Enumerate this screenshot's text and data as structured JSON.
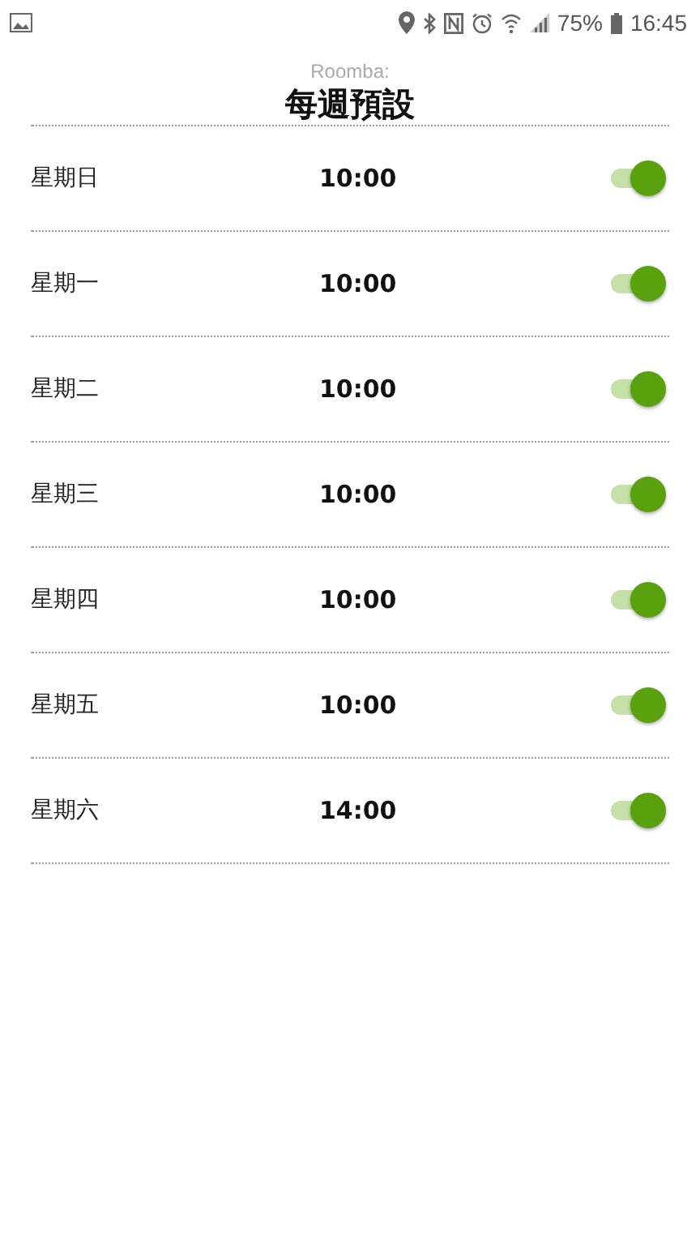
{
  "status_bar": {
    "battery": "75%",
    "time": "16:45"
  },
  "header": {
    "subtitle": "Roomba:",
    "title": "每週預設"
  },
  "schedule": [
    {
      "day": "星期日",
      "time": "10:00",
      "on": true
    },
    {
      "day": "星期一",
      "time": "10:00",
      "on": true
    },
    {
      "day": "星期二",
      "time": "10:00",
      "on": true
    },
    {
      "day": "星期三",
      "time": "10:00",
      "on": true
    },
    {
      "day": "星期四",
      "time": "10:00",
      "on": true
    },
    {
      "day": "星期五",
      "time": "10:00",
      "on": true
    },
    {
      "day": "星期六",
      "time": "14:00",
      "on": true
    }
  ]
}
